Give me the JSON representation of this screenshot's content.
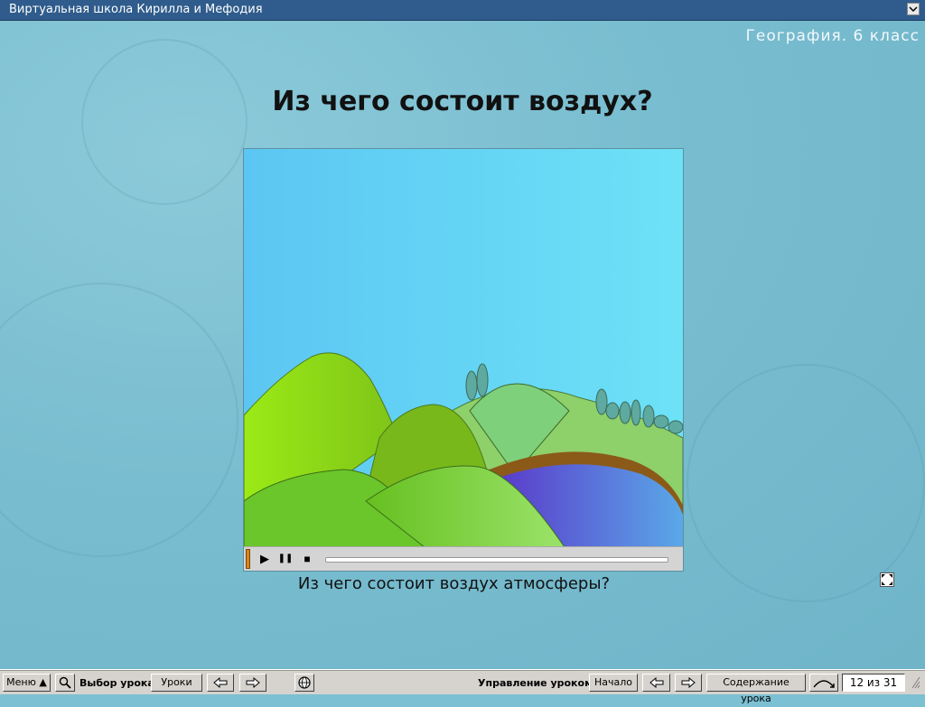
{
  "window": {
    "title": "Виртуальная школа Кирилла и Мефодия",
    "dropdown_icon": "chevron-down-icon"
  },
  "lesson": {
    "subject": "География. 6 класс",
    "heading": "Из чего состоит воздух?",
    "caption": "Из чего состоит воздух атмосферы?"
  },
  "player": {
    "play_icon": "▶",
    "pause_icon": "❚❚",
    "stop_icon": "■",
    "progress": 0.0
  },
  "toolbar": {
    "menu_label": "Меню ▲",
    "lesson_select_label": "Выбор урока:",
    "lessons_button": "Уроки",
    "lesson_control_label": "Управление уроком:",
    "start_button": "Начало",
    "contents_button": "Содержание урока",
    "page_counter": "12 из 31"
  },
  "colors": {
    "titlebar": "#2f5c8c",
    "background": "#7cc0d3",
    "toolbar": "#d6d3ce"
  }
}
